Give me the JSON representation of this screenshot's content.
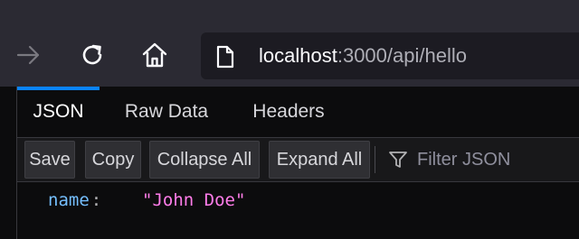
{
  "browser": {
    "url_host": "localhost",
    "url_rest": ":3000/api/hello"
  },
  "viewer": {
    "tabs": [
      {
        "label": "JSON",
        "active": true
      },
      {
        "label": "Raw Data",
        "active": false
      },
      {
        "label": "Headers",
        "active": false
      }
    ],
    "toolbar": {
      "save_label": "Save",
      "copy_label": "Copy",
      "collapse_label": "Collapse All",
      "expand_label": "Expand All",
      "filter_placeholder": "Filter JSON"
    },
    "json": {
      "rows": [
        {
          "key": "name",
          "colon": ":",
          "value": "\"John Doe\""
        }
      ]
    }
  },
  "colors": {
    "accent": "#0a84ff",
    "key": "#75bfff",
    "string_value": "#ff7de9"
  }
}
